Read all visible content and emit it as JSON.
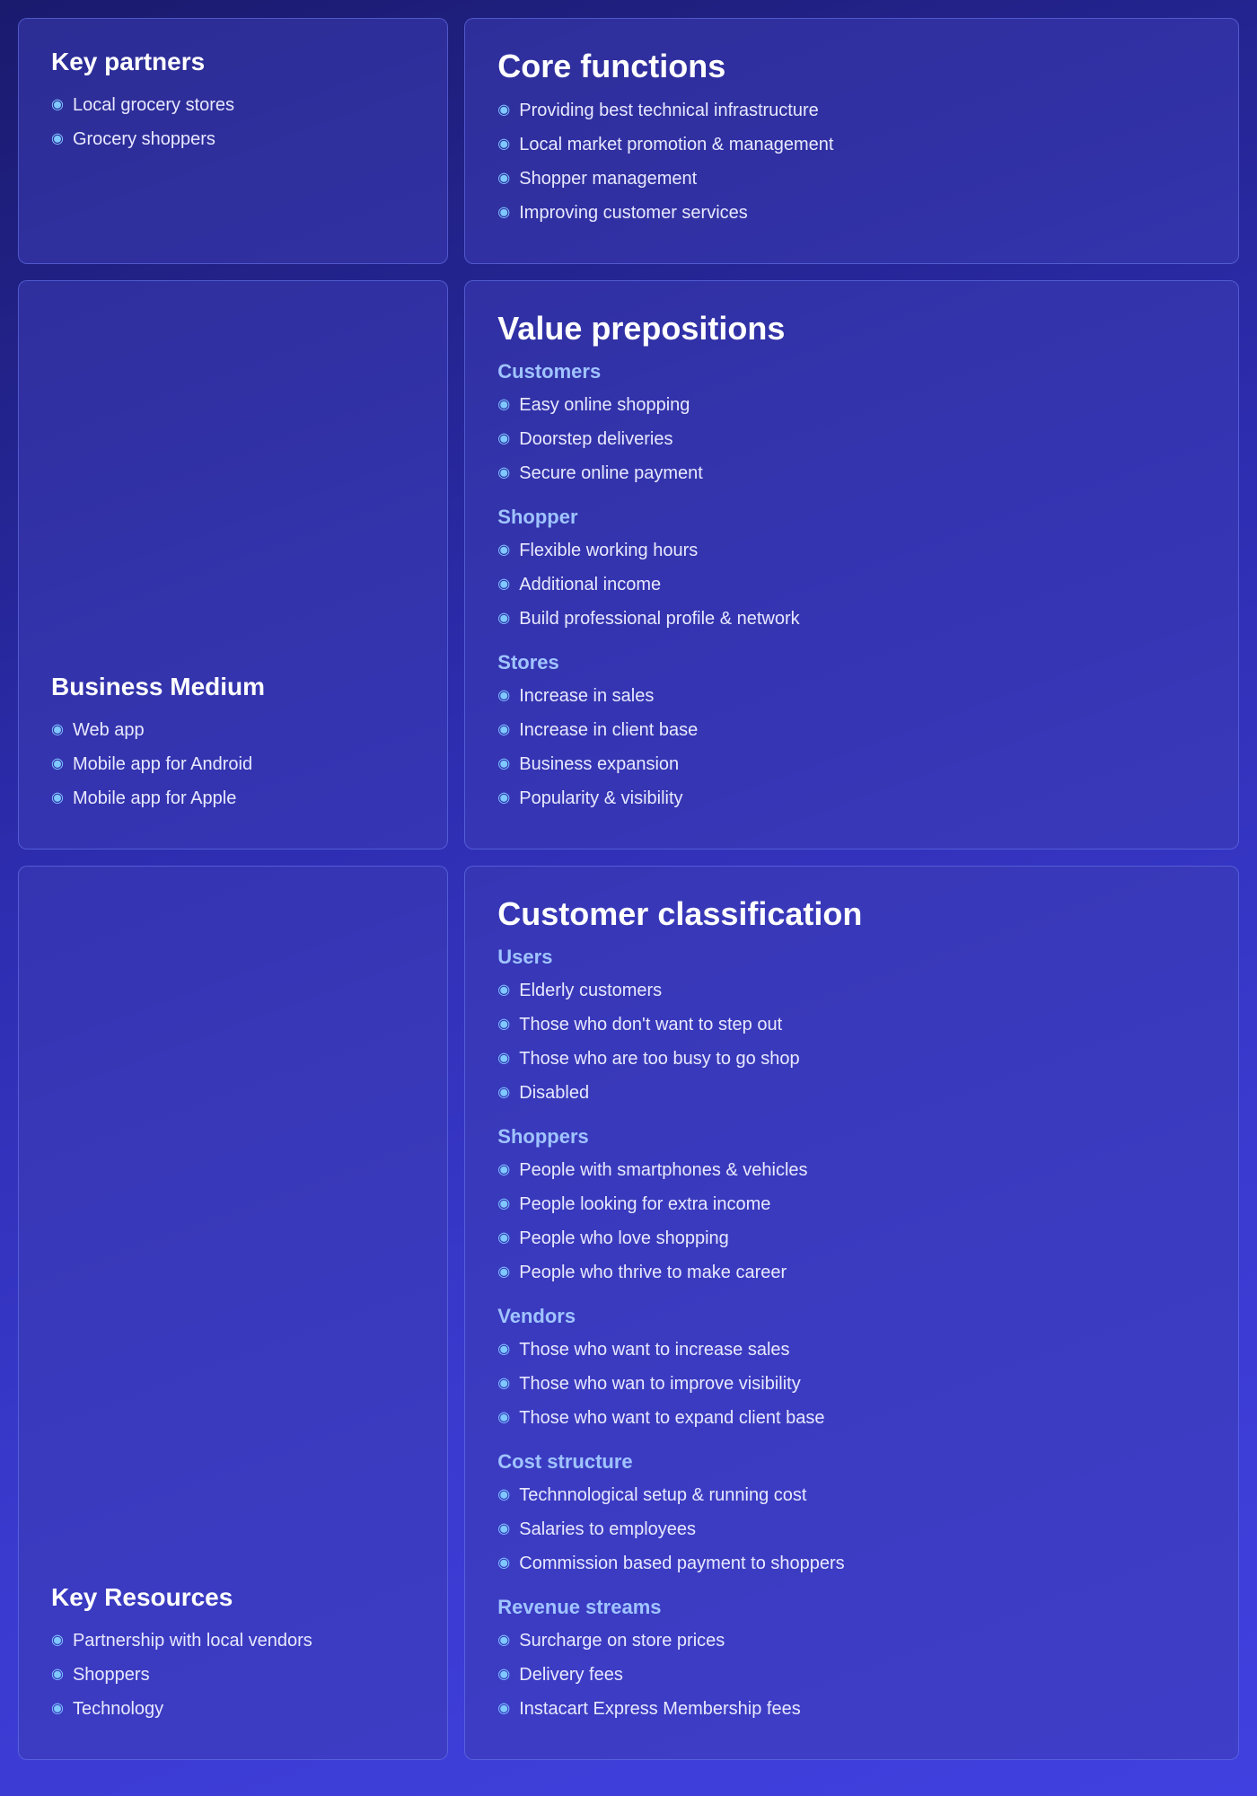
{
  "keyPartners": {
    "title": "Key partners",
    "items": [
      "Local grocery stores",
      "Grocery shoppers"
    ]
  },
  "coreFunctions": {
    "title": "Core functions",
    "items": [
      "Providing best technical infrastructure",
      "Local market promotion & management",
      "Shopper management",
      "Improving customer services"
    ]
  },
  "businessMedium": {
    "title": "Business Medium",
    "items": [
      "Web app",
      "Mobile app for Android",
      "Mobile app for Apple"
    ]
  },
  "valuePrepositions": {
    "title": "Value prepositions",
    "sections": [
      {
        "heading": "Customers",
        "items": [
          "Easy online shopping",
          "Doorstep deliveries",
          "Secure online payment"
        ]
      },
      {
        "heading": "Shopper",
        "items": [
          "Flexible working hours",
          "Additional income",
          "Build professional profile & network"
        ]
      },
      {
        "heading": "Stores",
        "items": [
          "Increase in sales",
          "Increase in client base",
          "Business expansion",
          "Popularity & visibility"
        ]
      }
    ]
  },
  "keyResources": {
    "title": "Key Resources",
    "items": [
      "Partnership with local vendors",
      "Shoppers",
      "Technology"
    ]
  },
  "customerClassification": {
    "title": "Customer classification",
    "sections": [
      {
        "heading": "Users",
        "items": [
          "Elderly customers",
          "Those who don't want to step out",
          "Those who are too busy to go shop",
          "Disabled"
        ]
      },
      {
        "heading": "Shoppers",
        "items": [
          "People with smartphones & vehicles",
          "People looking for extra income",
          "People who love shopping",
          "People who thrive to make career"
        ]
      },
      {
        "heading": "Vendors",
        "items": [
          "Those who want to increase sales",
          "Those who wan to improve visibility",
          "Those who want to expand client base"
        ]
      },
      {
        "heading": "Cost structure",
        "items": [
          "Technnological setup & running cost",
          "Salaries to employees",
          "Commission based payment to shoppers"
        ]
      },
      {
        "heading": "Revenue streams",
        "items": [
          "Surcharge on store prices",
          "Delivery fees",
          "Instacart Express Membership fees"
        ]
      }
    ]
  }
}
